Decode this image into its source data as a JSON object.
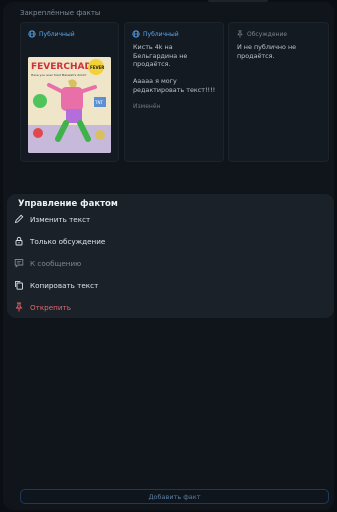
{
  "section": {
    "title": "Закреплённые факты"
  },
  "cards": [
    {
      "badge": "Публичный",
      "badge_type": "public",
      "icon": "globe-icon",
      "image": {
        "headline": "FEVERCHAD",
        "caption": "Have you ever tried Maxwell's drink?",
        "label_sun": "FEVER",
        "label_drink": "TNT"
      }
    },
    {
      "badge": "Публичный",
      "badge_type": "public",
      "icon": "globe-icon",
      "text": "Кисть 4k на\nБельгардина не\nпродаётся.\n\nАаааа я могу\nредактировать текст!!!!",
      "edit": "Изменён"
    },
    {
      "badge": "Обсуждение",
      "badge_type": "discussion",
      "icon": "pin-icon",
      "text": "И не публично не\nпродаётся."
    }
  ],
  "sheet": {
    "title": "Управление фактом",
    "items": [
      {
        "label": "Изменить текст",
        "icon": "pencil-icon",
        "state": "normal"
      },
      {
        "label": "Только обсуждение",
        "icon": "lock-icon",
        "state": "normal"
      },
      {
        "label": "К сообщению",
        "icon": "message-icon",
        "state": "disabled"
      },
      {
        "label": "Копировать текст",
        "icon": "copy-icon",
        "state": "normal"
      },
      {
        "label": "Открепить",
        "icon": "unpin-icon",
        "state": "danger"
      }
    ]
  },
  "footer": {
    "add_button": "Добавить факт"
  },
  "colors": {
    "accent": "#5aa8f2",
    "danger": "#e8636a",
    "sheet_bg": "#1a2129",
    "page_bg": "#0b0f14"
  }
}
